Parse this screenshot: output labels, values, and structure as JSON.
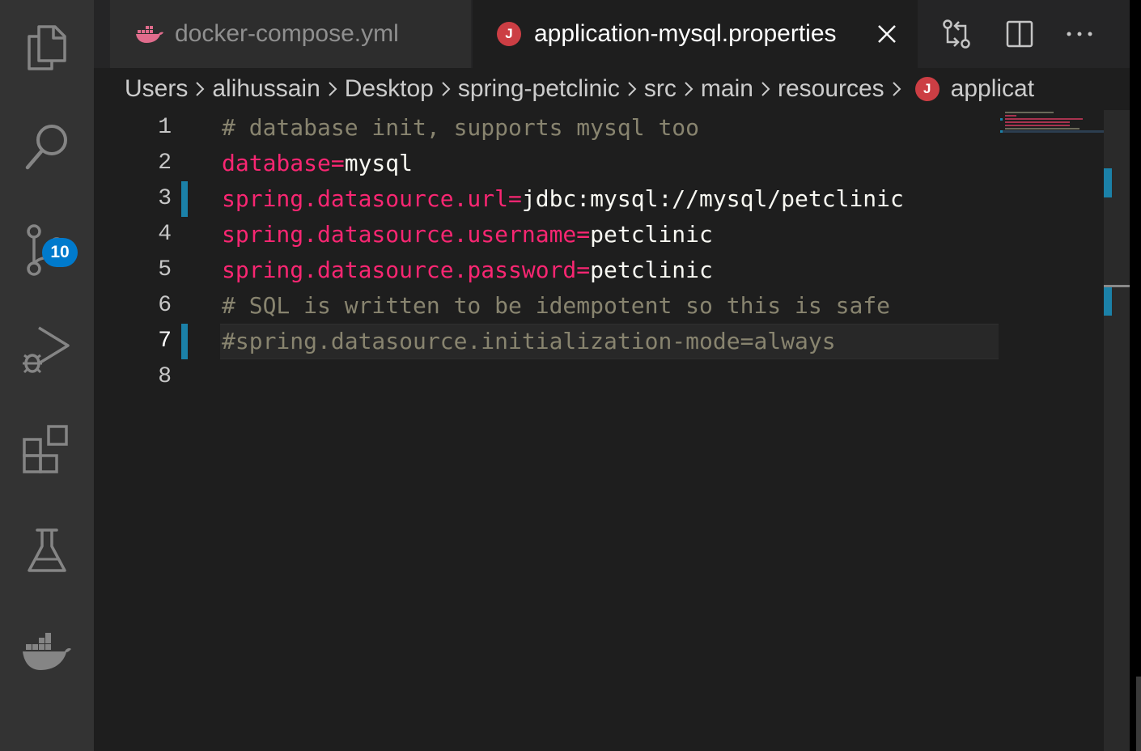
{
  "activity_bar": {
    "items": [
      {
        "name": "explorer",
        "icon": "files-icon"
      },
      {
        "name": "search",
        "icon": "search-icon"
      },
      {
        "name": "source-control",
        "icon": "source-control-icon",
        "badge": "10"
      },
      {
        "name": "run-debug",
        "icon": "run-debug-icon"
      },
      {
        "name": "extensions",
        "icon": "extensions-icon"
      },
      {
        "name": "testing",
        "icon": "flask-icon"
      },
      {
        "name": "docker",
        "icon": "docker-icon"
      }
    ]
  },
  "tabs": [
    {
      "label": "docker-compose.yml",
      "icon": "docker-icon",
      "active": false
    },
    {
      "label": "application-mysql.properties",
      "icon": "java-icon",
      "icon_text": "J",
      "active": true
    }
  ],
  "editor_actions": [
    "open-changes-icon",
    "split-editor-icon",
    "more-actions-icon"
  ],
  "breadcrumb": {
    "items": [
      "Users",
      "alihussain",
      "Desktop",
      "spring-petclinic",
      "src",
      "main",
      "resources"
    ],
    "file_icon_text": "J",
    "file_label": "applicat"
  },
  "editor": {
    "lines": [
      {
        "number": "1",
        "comment": "# database init, supports mysql too"
      },
      {
        "number": "2",
        "key": "database=",
        "value": "mysql"
      },
      {
        "number": "3",
        "key": "spring.datasource.url=",
        "value": "jdbc:mysql://mysql/petclinic",
        "modified": true
      },
      {
        "number": "4",
        "key": "spring.datasource.username=",
        "value": "petclinic"
      },
      {
        "number": "5",
        "key": "spring.datasource.password=",
        "value": "petclinic"
      },
      {
        "number": "6",
        "comment": "# SQL is written to be idempotent so this is safe"
      },
      {
        "number": "7",
        "comment": "#spring.datasource.initialization-mode=always",
        "modified": true,
        "current": true
      },
      {
        "number": "8"
      }
    ]
  },
  "colors": {
    "key": "#f92672",
    "value": "#f8f8f2",
    "comment": "#88846f",
    "accent": "#007acc",
    "java": "#cc3e44",
    "docker": "#e06c8c",
    "modified_gutter": "#1b81a8"
  }
}
